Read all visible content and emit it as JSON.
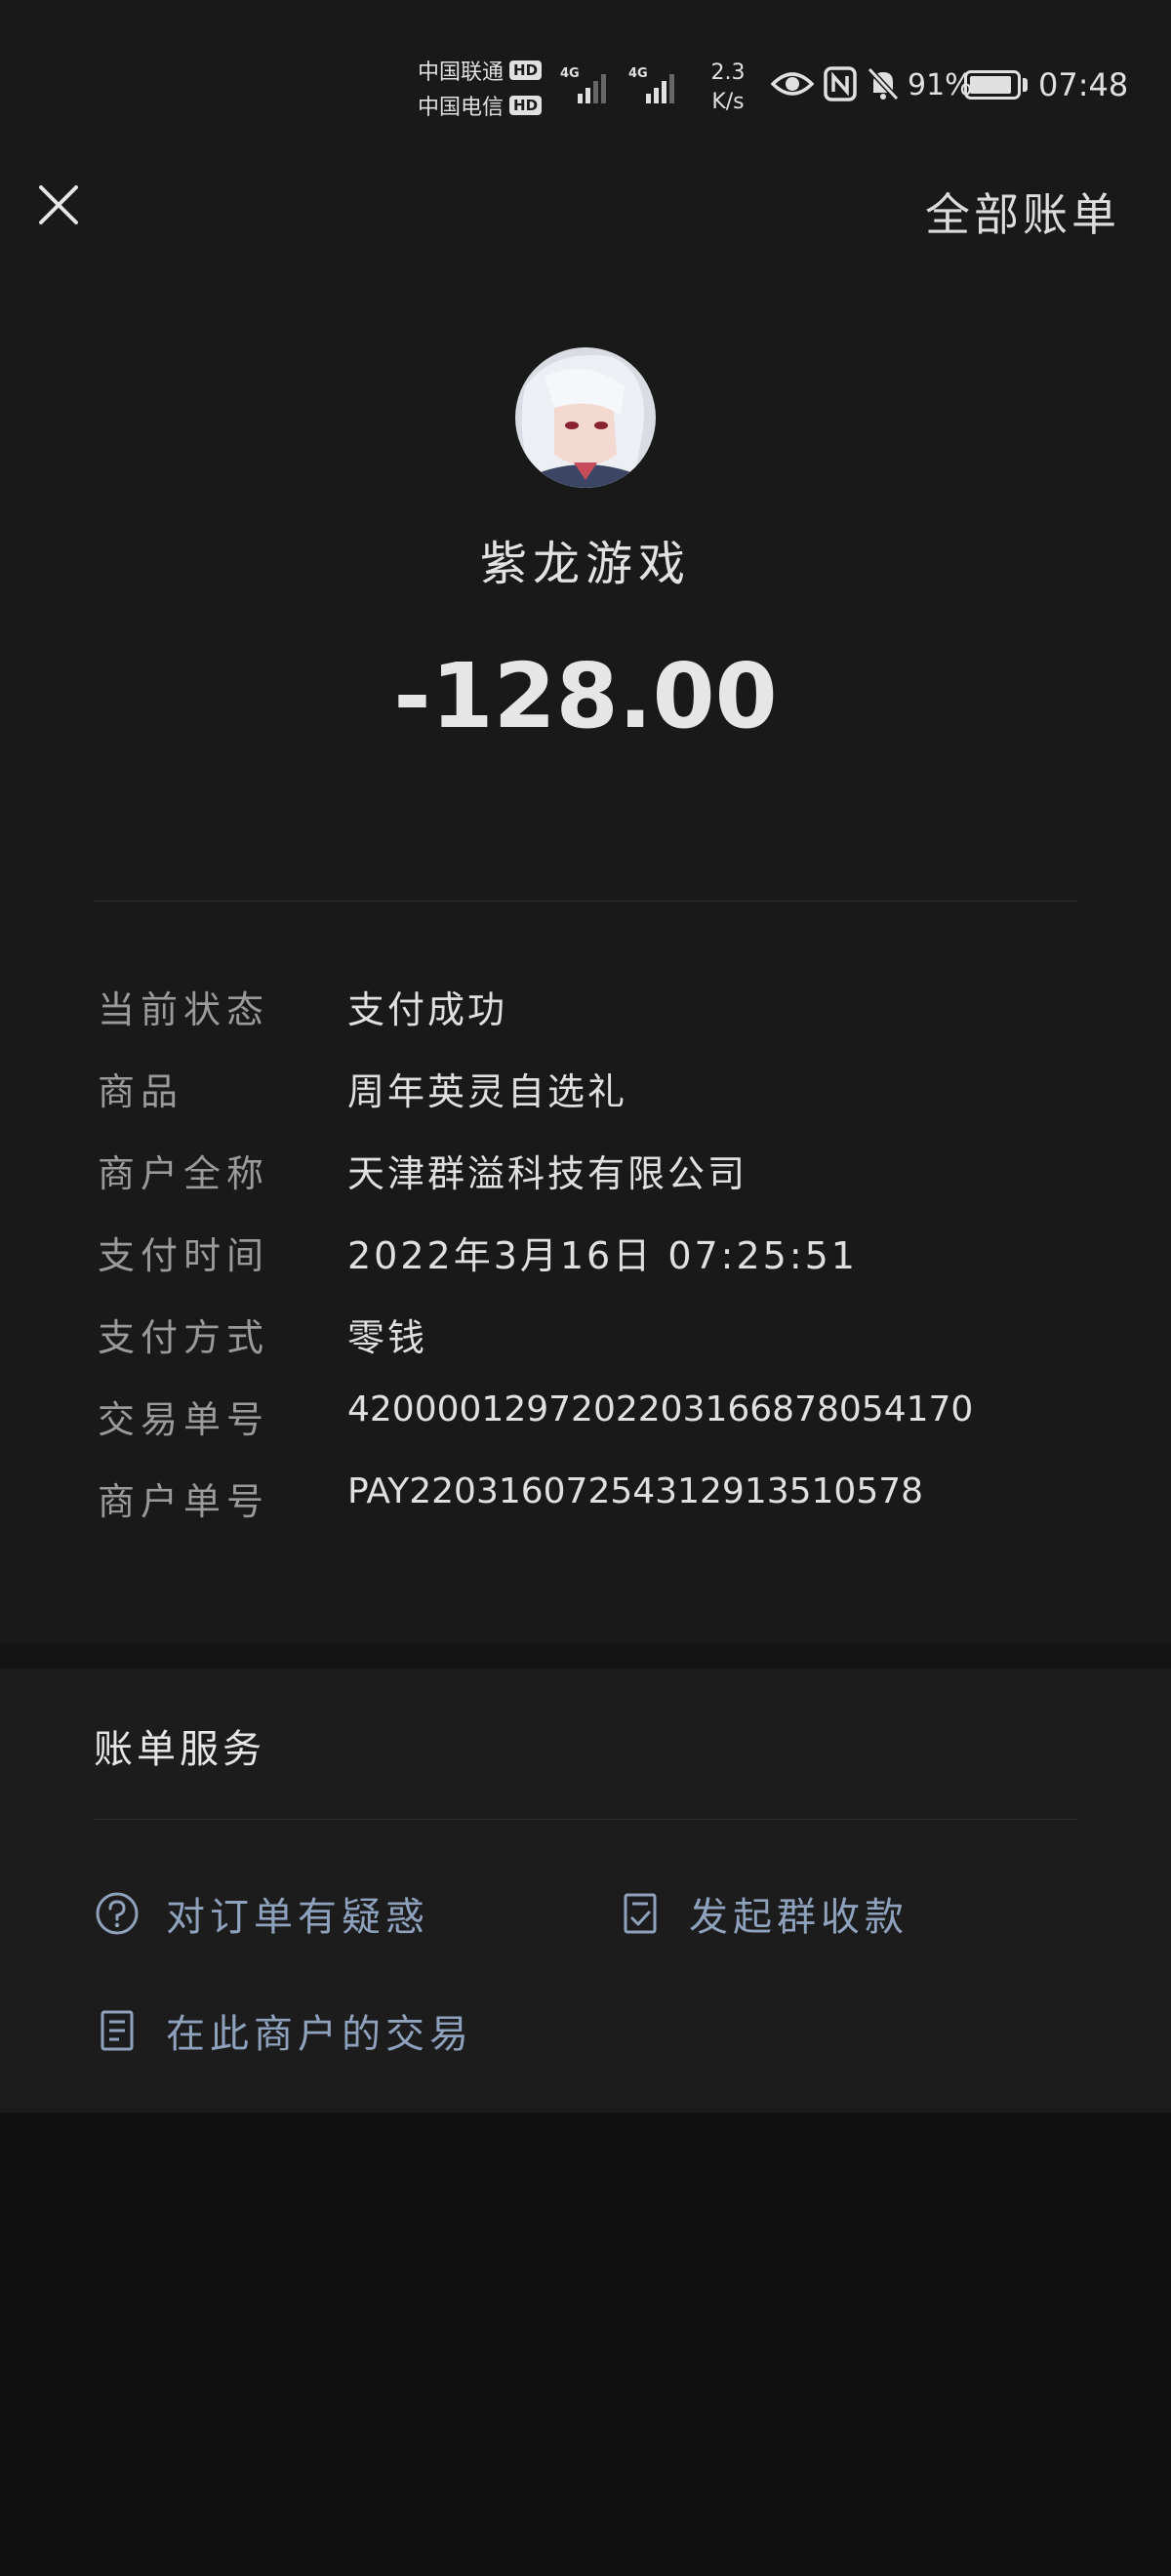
{
  "status_bar": {
    "carrier1": "中国联通",
    "carrier2": "中国电信",
    "hd": "HD",
    "net_type": "4G",
    "speed_value": "2.3",
    "speed_unit": "K/s",
    "battery_percent": "91%",
    "battery_level": 0.91,
    "time": "07:48",
    "icons": [
      "eye-icon",
      "nfc-icon",
      "bell-muted-icon",
      "battery-icon"
    ]
  },
  "header": {
    "close_icon": "close-icon",
    "all_bills": "全部账单"
  },
  "merchant": {
    "name": "紫龙游戏",
    "amount": "-128.00"
  },
  "details": [
    {
      "label": "当前状态",
      "value": "支付成功"
    },
    {
      "label": "商品",
      "value": "周年英灵自选礼"
    },
    {
      "label": "商户全称",
      "value": "天津群溢科技有限公司"
    },
    {
      "label": "支付时间",
      "value": "2022年3月16日 07:25:51"
    },
    {
      "label": "支付方式",
      "value": "零钱"
    },
    {
      "label": "交易单号",
      "value": "4200001297202203166878054170"
    },
    {
      "label": "商户单号",
      "value": "PAY22031607254312913510578"
    }
  ],
  "services": {
    "title": "账单服务",
    "items": [
      {
        "label": "对订单有疑惑",
        "icon": "question-circle-icon"
      },
      {
        "label": "发起群收款",
        "icon": "checklist-icon"
      },
      {
        "label": "在此商户的交易",
        "icon": "document-icon"
      }
    ]
  },
  "colors": {
    "background": "#191919",
    "page_bottom": "#111111",
    "text_primary": "#e6e6e6",
    "text_secondary": "#9a9a9a",
    "link": "#8fa2bd"
  }
}
